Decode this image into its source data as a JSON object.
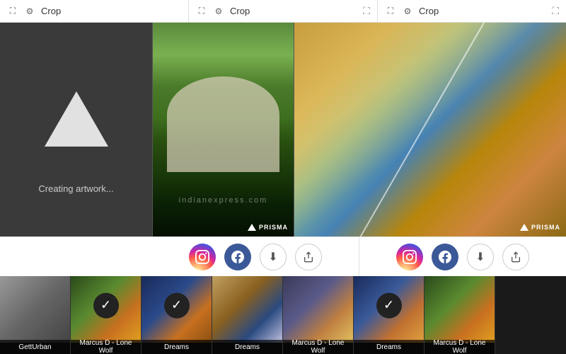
{
  "topbar": {
    "sections": [
      {
        "label": "Crop",
        "icon": "✂",
        "settings_icon": "⚙",
        "expand_icon": "⛶"
      },
      {
        "label": "Crop",
        "icon": "✂",
        "settings_icon": "⚙",
        "expand_icon": "⛶"
      },
      {
        "label": "Crop",
        "icon": "✂",
        "settings_icon": "⚙",
        "expand_icon": "⛶"
      }
    ]
  },
  "panel1": {
    "creating_text": "Creating artwork..."
  },
  "panel2": {
    "watermark": "indianexpress.com",
    "prisma_label": "PRISMA"
  },
  "panel3": {
    "prisma_label": "PRISMA"
  },
  "actions": {
    "instagram_label": "Instagram",
    "facebook_label": "Facebook",
    "download_label": "Download",
    "share_label": "Share"
  },
  "filmstrip": {
    "items": [
      {
        "id": 1,
        "label": "GettUrban",
        "checked": false,
        "bg_class": "thumb-bg-1"
      },
      {
        "id": 2,
        "label": "Marcus D - Lone Wolf",
        "checked": true,
        "bg_class": "thumb-bg-2"
      },
      {
        "id": 3,
        "label": "Dreams",
        "checked": true,
        "bg_class": "thumb-bg-3"
      },
      {
        "id": 4,
        "label": "Dreams",
        "checked": false,
        "bg_class": "thumb-bg-4"
      },
      {
        "id": 5,
        "label": "Marcus D - Lone Wolf",
        "checked": false,
        "bg_class": "thumb-bg-5"
      },
      {
        "id": 6,
        "label": "Dreams",
        "checked": true,
        "bg_class": "thumb-bg-6"
      },
      {
        "id": 7,
        "label": "Marcus D - Lone Wolf",
        "checked": false,
        "bg_class": "thumb-bg-2"
      }
    ]
  }
}
